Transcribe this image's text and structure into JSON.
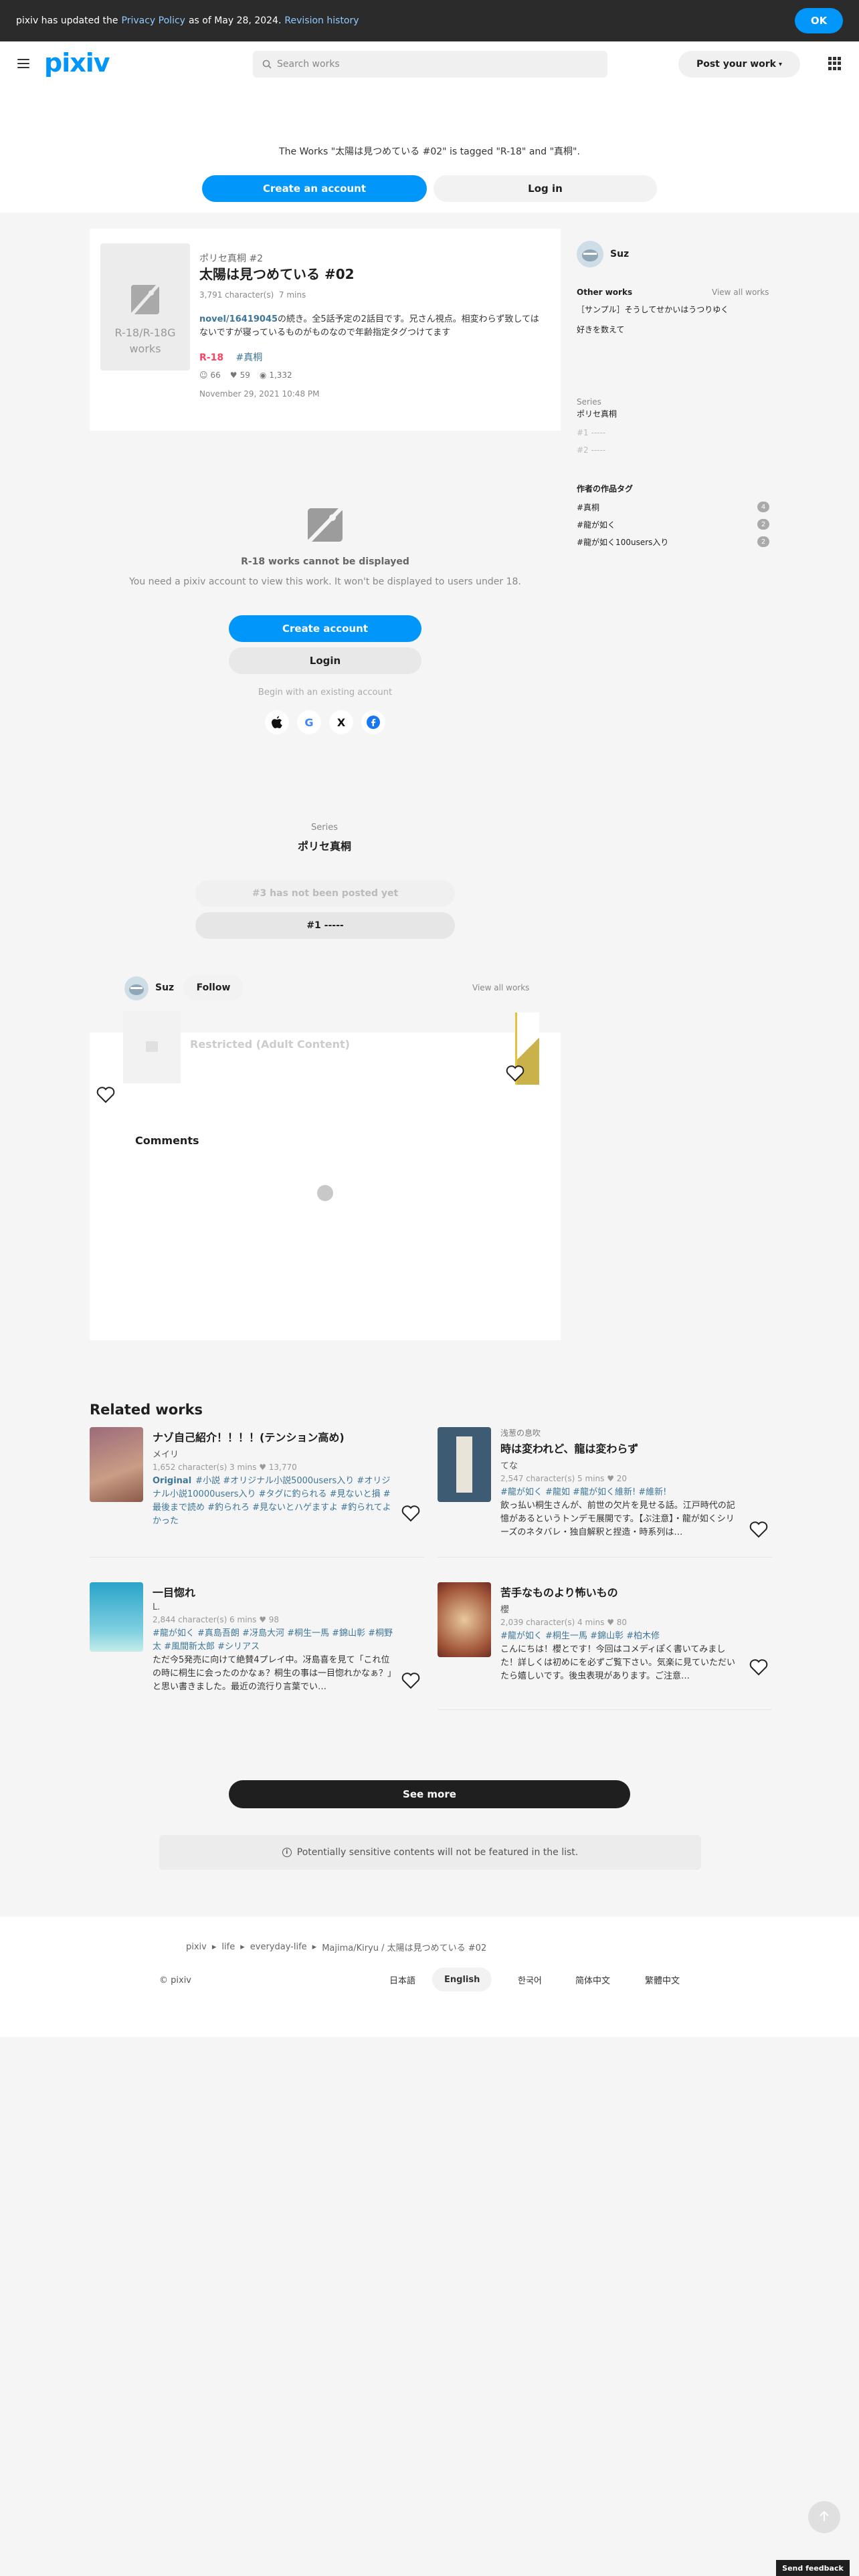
{
  "banner": {
    "text_before": "pixiv has updated the",
    "privacy_link": "Privacy Policy",
    "text_after": "as of May 28, 2024.",
    "revision_link": "Revision history",
    "ok_label": "OK"
  },
  "header": {
    "logo": "pixiv",
    "search_placeholder": "Search works",
    "post_label": "Post your work"
  },
  "notice": {
    "message": "The Works \"太陽は見つめている #02\" is tagged \"R-18\" and \"真桐\".",
    "create_label": "Create an account",
    "login_label": "Log in"
  },
  "work": {
    "thumb_text_1": "R-18/R-18G",
    "thumb_text_2": "works",
    "series": "ポリセ真桐 #2",
    "title": "太陽は見つめている #02",
    "chars": "3,791 character(s)",
    "read_time": "7 mins",
    "caption_link": "novel/16419045",
    "caption_text": "の続き。全5話予定の2話目です。兄さん視点。相変わらず致してはないですが寝っているものがものなので年齢指定タグつけてます",
    "tag_r18": "R-18",
    "tag_1": "#真桐",
    "likes": "66",
    "bookmarks": "59",
    "views": "1,332",
    "date": "November 29, 2021 10:48 PM"
  },
  "restricted": {
    "title": "R-18 works cannot be displayed",
    "subtitle": "You need a pixiv account to view this work. It won't be displayed to users under 18.",
    "create_label": "Create account",
    "login_label": "Login",
    "begin": "Begin with an existing account"
  },
  "series_box": {
    "label": "Series",
    "name": "ポリセ真桐",
    "next": "#3 has not been posted yet",
    "first": "#1 -----"
  },
  "author": {
    "name": "Suz",
    "follow": "Follow",
    "view_all": "View all works"
  },
  "restricted_card": "Restricted (Adult Content)",
  "comments_title": "Comments",
  "sidebar": {
    "user": "Suz",
    "other_works": "Other works",
    "view_all": "View all works",
    "work_1": "［サンプル］そうしてせかいはうつりゆく",
    "work_2": "好きを数えて",
    "series_label": "Series",
    "series_name": "ポリセ真桐",
    "ep_1": "#1 -----",
    "ep_2": "#2 -----",
    "tags_title": "作者の作品タグ",
    "tags": [
      {
        "name": "#真桐",
        "count": "4"
      },
      {
        "name": "#龍が如く",
        "count": "2"
      },
      {
        "name": "#龍が如く100users入り",
        "count": "2"
      }
    ]
  },
  "related": {
    "title": "Related works",
    "items": [
      {
        "sub": "",
        "name": "ナゾ自己紹介！！！！(テンション高め)",
        "author": "メイリ",
        "meta": "1,652 character(s)  3 mins  ♥ 13,770",
        "original": "Original",
        "tags": "#小説 #オリジナル小説5000users入り #オリジナル小説10000users入り #タグに釣られる #見ないと損 #最後まで読め #釣られろ #見ないとハゲますよ #釣られてよかった",
        "desc": ""
      },
      {
        "sub": "浅葱の息吹",
        "name": "時は変われど、龍は変わらず",
        "author": "てな",
        "meta": "2,547 character(s)  5 mins  ♥ 20",
        "original": "",
        "tags": "#龍が如く #龍如 #龍が如く維新! #維新!",
        "desc": "飲っ払い桐生さんが、前世の欠片を見せる話。江戸時代の記憶があるというトンデモ展開です。【ぶ注意】・龍が如くシリーズのネタバレ・独自解釈と捏造・時系列は…"
      },
      {
        "sub": "",
        "name": "一目惚れ",
        "author": "L.",
        "meta": "2,844 character(s)  6 mins  ♥ 98",
        "original": "",
        "tags": "#龍が如く #真島吾朗 #冴島大河 #桐生一馬 #錦山彰 #桐野太 #風間新太郎 #シリアス",
        "desc": "ただ今5発売に向けて絶賛4プレイ中。冴島喜を見て「これ位の時に桐生に会ったのかなぁ？桐生の事は一目惚れかなぁ？」と思い書きました。最近の流行り言葉でい…"
      },
      {
        "sub": "",
        "name": "苦手なものより怖いもの",
        "author": "櫻",
        "meta": "2,039 character(s)  4 mins  ♥ 80",
        "original": "",
        "tags": "#龍が如く #桐生一馬 #錦山彰 #柏木修",
        "desc": "こんにちは！櫻とです！今回はコメディぽく書いてみました！詳しくは初めにを必ずご覧下さい。気楽に見ていただいたら嬉しいです。後虫表現があります。ご注意…"
      }
    ]
  },
  "see_more": "See more",
  "sensitive_note": "Potentially sensitive contents will not be featured in the list.",
  "footer": {
    "crumbs": [
      "pixiv",
      "life",
      "everyday-life",
      "Majima/Kiryu / 太陽は見つめている #02"
    ],
    "copyright": "© pixiv",
    "langs": [
      "日本語",
      "English",
      "한국어",
      "简体中文",
      "繁體中文"
    ]
  },
  "feedback": "Send feedback"
}
